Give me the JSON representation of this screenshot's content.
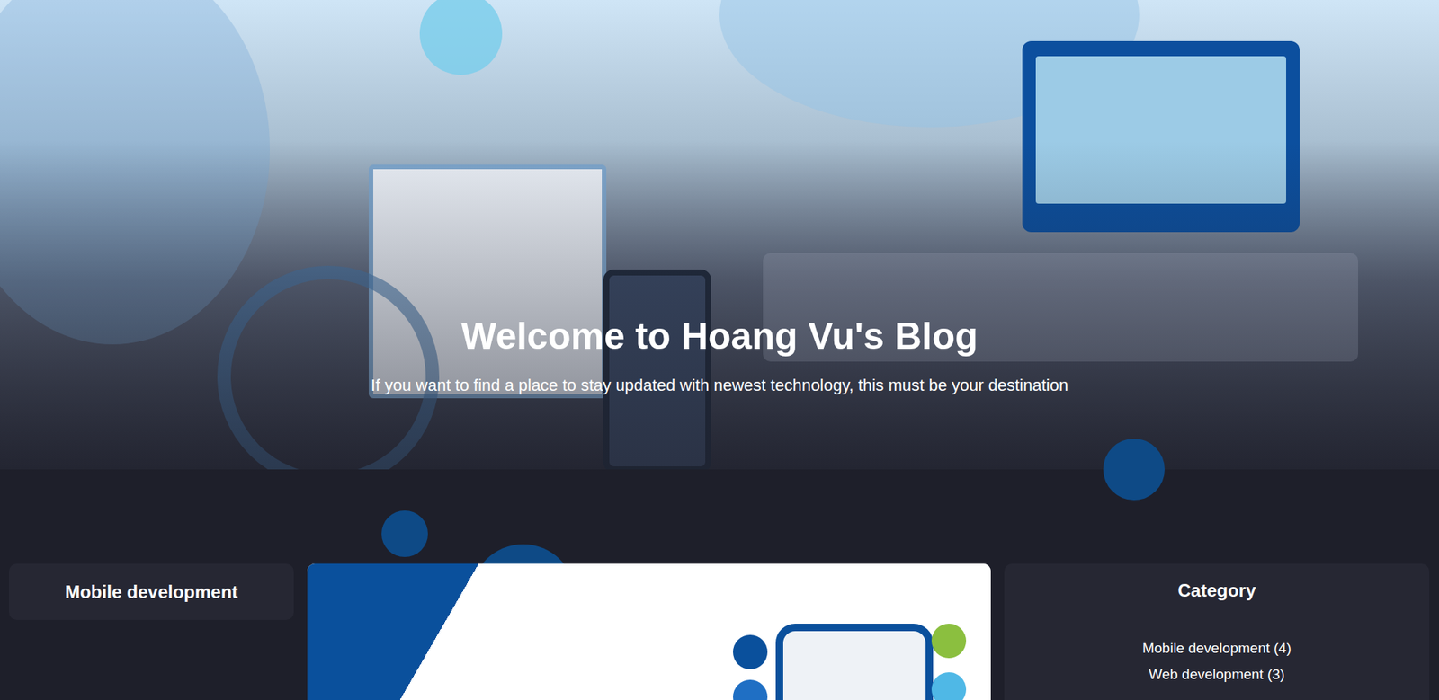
{
  "hero": {
    "title": "Welcome to Hoang Vu's Blog",
    "subtitle": "If you want to find a place to stay updated with newest technology, this must be your destination"
  },
  "current_category": {
    "title": "Mobile development"
  },
  "category": {
    "title": "Category",
    "items": [
      {
        "label": "Mobile development (4)"
      },
      {
        "label": "Web development (3)"
      }
    ]
  }
}
